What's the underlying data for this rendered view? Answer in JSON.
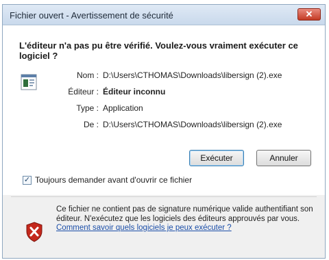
{
  "window": {
    "title": "Fichier ouvert - Avertissement de sécurité",
    "close_label": "✕"
  },
  "dialog": {
    "heading": "L'éditeur n'a pas pu être vérifié. Voulez-vous vraiment exécuter ce logiciel ?",
    "file_icon": "application-file-icon",
    "details": [
      {
        "label": "Nom :",
        "value": "D:\\Users\\CTHOMAS\\Downloads\\libersign (2).exe",
        "bold": false
      },
      {
        "label": "Éditeur :",
        "value": "Éditeur inconnu",
        "bold": true
      },
      {
        "label": "Type :",
        "value": "Application",
        "bold": false
      },
      {
        "label": "De :",
        "value": "D:\\Users\\CTHOMAS\\Downloads\\libersign (2).exe",
        "bold": false
      }
    ],
    "buttons": {
      "run": "Exécuter",
      "cancel": "Annuler"
    },
    "checkbox": {
      "label": "Toujours demander avant d'ouvrir ce fichier",
      "checked": true
    },
    "warning": {
      "icon": "shield-x-icon",
      "text": "Ce fichier ne contient pas de signature numérique valide authentifiant son éditeur. N'exécutez que les logiciels des éditeurs approuvés par vous. ",
      "link": "Comment savoir quels logiciels je peux exécuter ?"
    }
  }
}
